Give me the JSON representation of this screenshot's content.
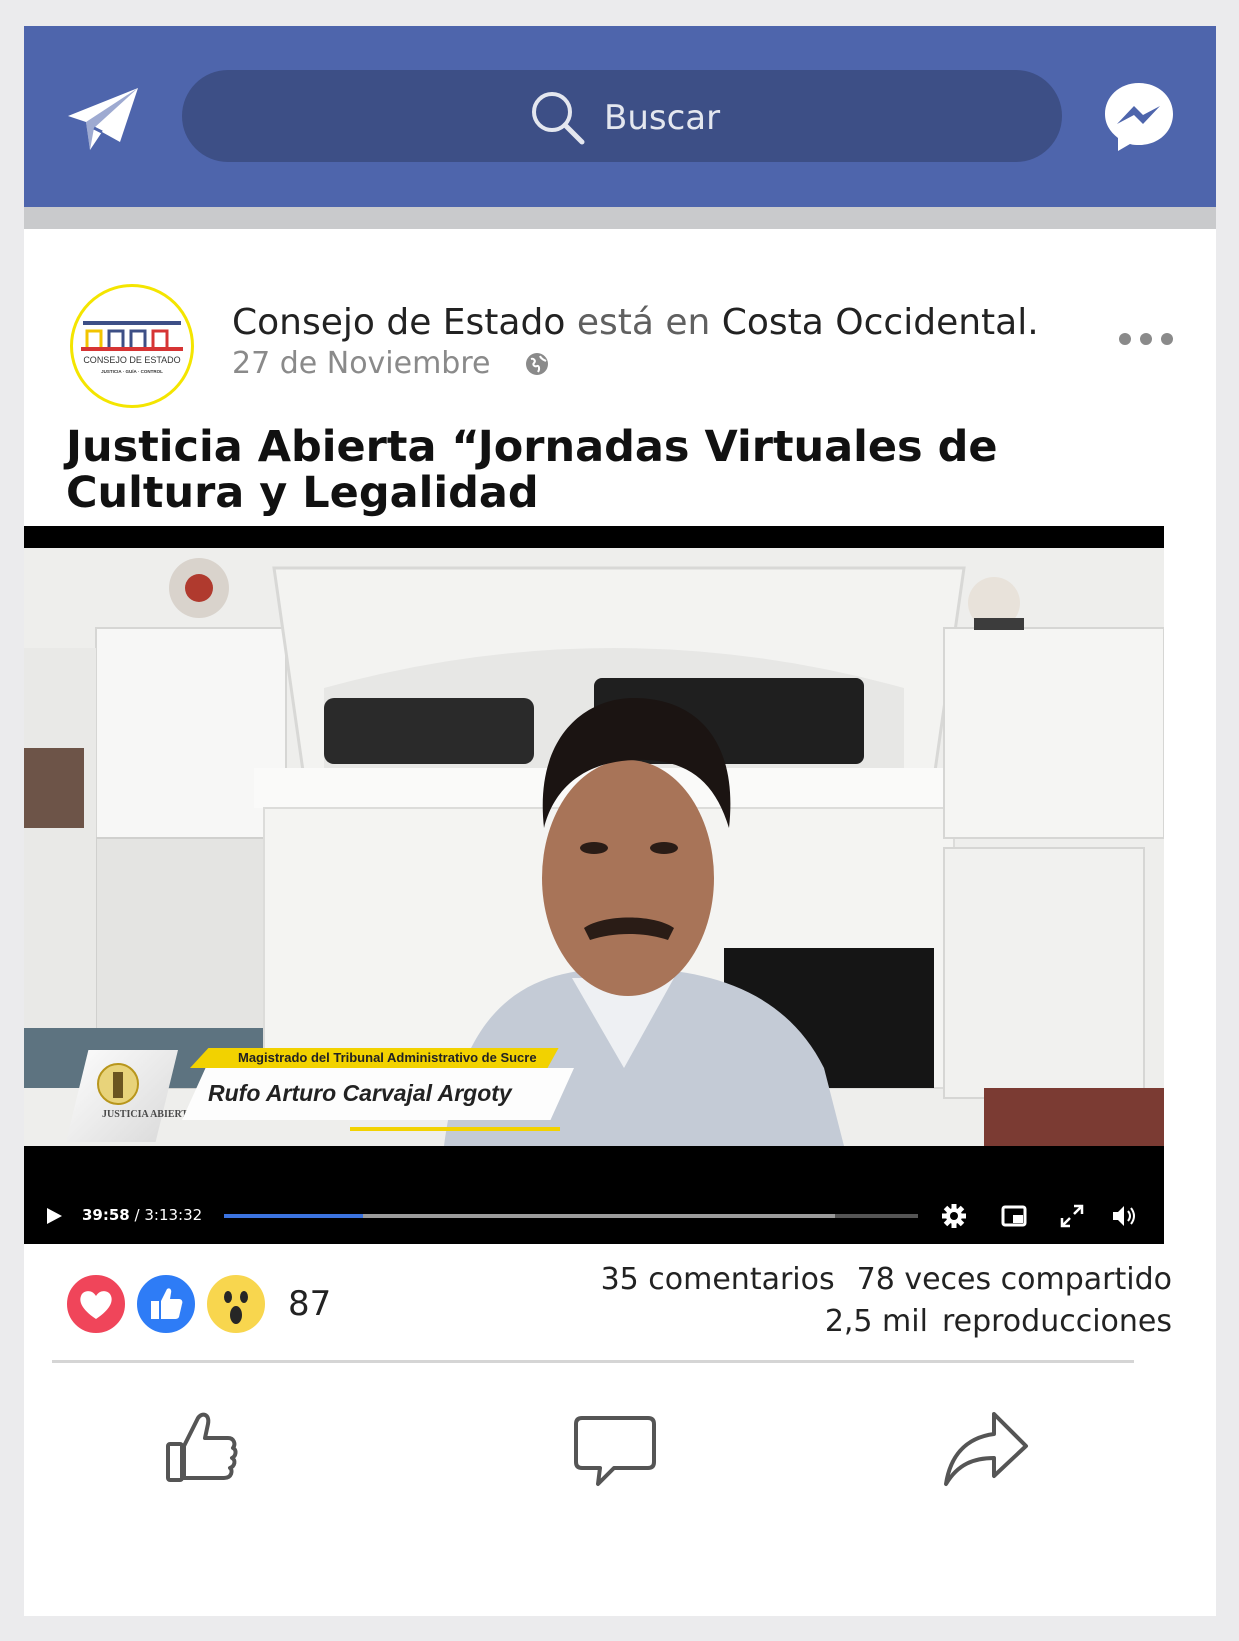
{
  "header": {
    "search_placeholder": "Buscar",
    "brand_color": "#4e65ac",
    "icons": [
      "send-icon",
      "search-icon",
      "messenger-icon"
    ]
  },
  "post": {
    "author": "Consejo de Estado",
    "location_connector": "está en",
    "location": "Costa Occidental.",
    "date": "27 de Noviembre",
    "title": "Justicia Abierta “Jornadas Virtuales de Cultura y Legalidad",
    "avatar_logo_text": "CONSEJO DE ESTADO",
    "avatar_logo_tagline": "JUSTICIA · GUÍA · CONTROL"
  },
  "video": {
    "lower_third_role": "Magistrado del Tribunal Administrativo de Sucre",
    "lower_third_name": "Rufo Arturo Carvajal Argoty",
    "lower_third_logo": "JUSTICIA ABIERTA",
    "current_time": "39:58",
    "duration": "3:13:32",
    "played_fraction": 0.2,
    "buffered_fraction": 0.88
  },
  "stats": {
    "reactions": [
      "love",
      "like",
      "wow"
    ],
    "reaction_count": "87",
    "comments": "35 comentarios",
    "shares": "78 veces compartido",
    "views_count": "2,5 mil",
    "views_label": "reproducciones"
  },
  "actions": [
    "like-icon",
    "comment-icon",
    "share-icon"
  ]
}
